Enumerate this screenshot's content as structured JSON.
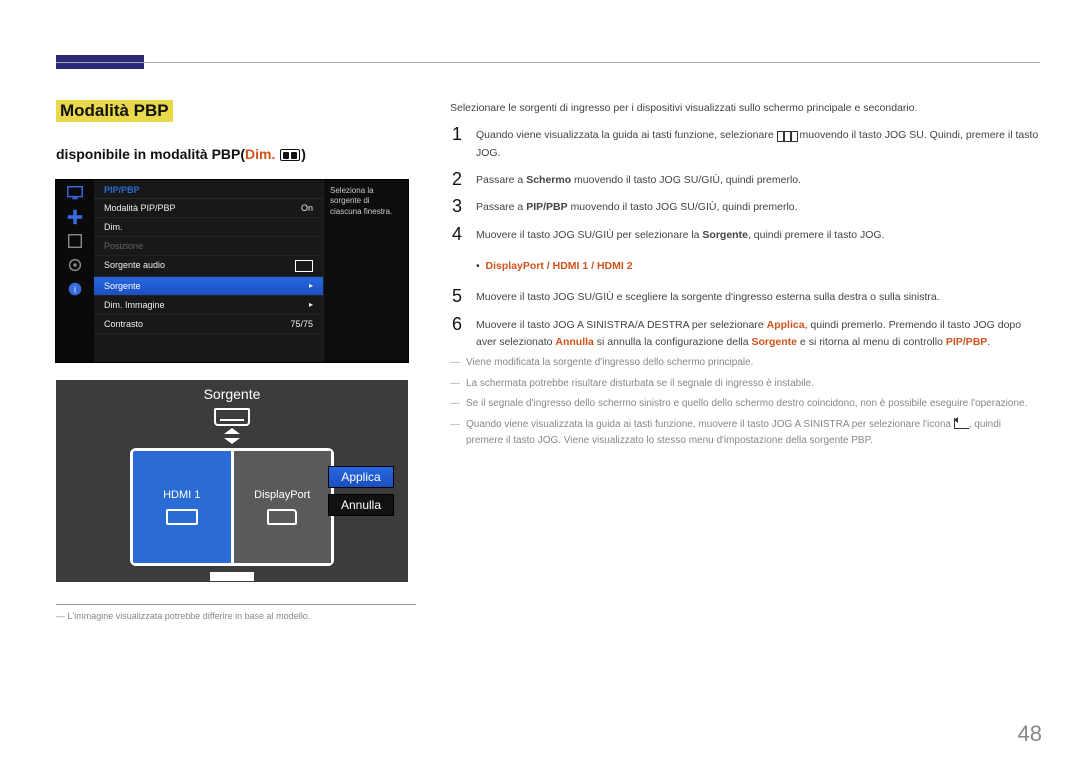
{
  "section_title": "Modalità PBP",
  "subtitle_prefix": "disponibile in modalità PBP(",
  "subtitle_dim": "Dim.",
  "subtitle_suffix": ")",
  "osd": {
    "header": "PIP/PBP",
    "side_help": "Seleziona la sorgente di ciascuna finestra.",
    "rows": {
      "r0_label": "Modalità PIP/PBP",
      "r0_value": "On",
      "r1_label": "Dim.",
      "r2_label": "Posizione",
      "r3_label": "Sorgente audio",
      "r4_label": "Sorgente",
      "r5_label": "Dim. Immagine",
      "r6_label": "Contrasto",
      "r6_value": "75/75"
    }
  },
  "dialog": {
    "title": "Sorgente",
    "left": "HDMI 1",
    "right": "DisplayPort",
    "apply": "Applica",
    "cancel": "Annulla"
  },
  "footnote": "L'immagine visualizzata potrebbe differire in base al modello.",
  "intro": "Selezionare le sorgenti di ingresso per i dispositivi visualizzati sullo schermo principale e secondario.",
  "steps": {
    "s1a": "Quando viene visualizzata la guida ai tasti funzione, selezionare ",
    "s1b": " muovendo il tasto JOG SU. Quindi, premere il tasto JOG.",
    "s2a": "Passare a ",
    "s2_bold": "Schermo",
    "s2b": " muovendo il tasto JOG SU/GIÙ, quindi premerlo.",
    "s3a": "Passare a ",
    "s3_bold": "PIP/PBP",
    "s3b": " muovendo il tasto JOG SU/GIÙ, quindi premerlo.",
    "s4a": "Muovere il tasto JOG SU/GIÙ per selezionare la ",
    "s4_bold": "Sorgente",
    "s4b": ", quindi premere il tasto JOG.",
    "ports_line": "DisplayPort / HDMI 1 / HDMI 2",
    "s5": "Muovere il tasto JOG SU/GIÙ e scegliere la sorgente d'ingresso esterna sulla destra o sulla sinistra.",
    "s6a": "Muovere il tasto JOG A SINISTRA/A DESTRA per selezionare ",
    "s6_apply": "Applica",
    "s6b": ", quindi premerlo. Premendo il tasto JOG dopo aver selezionato ",
    "s6_cancel": "Annulla",
    "s6c": " si annulla la configurazione della ",
    "s6_sorg": "Sorgente",
    "s6d": " e si ritorna al menu di controllo ",
    "s6_pip": "PIP/PBP",
    "s6e": "."
  },
  "notes": {
    "n1": "Viene modificata la sorgente d'ingresso dello schermo principale.",
    "n2": "La schermata potrebbe risultare disturbata se il segnale di ingresso è instabile.",
    "n3": "Se il segnale d'ingresso dello schermo sinistro e quello dello schermo destro coincidono, non è possibile eseguire l'operazione.",
    "n4a": "Quando viene visualizzata la guida ai tasti funzione, muovere il tasto JOG A SINISTRA per selezionare l'icona ",
    "n4b": ", quindi premere il tasto JOG. Viene visualizzato lo stesso menu d'impostazione della sorgente PBP."
  },
  "page_number": "48"
}
